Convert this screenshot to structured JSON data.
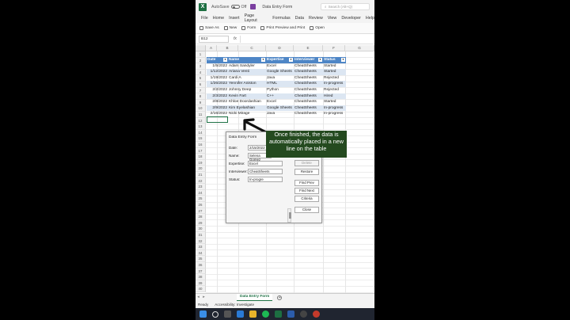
{
  "app": {
    "autosave_label": "AutoSave",
    "autosave_state": "Off",
    "doc_title": "Data Entry Form",
    "search_placeholder": "Search (Alt+Q)"
  },
  "menu": [
    "File",
    "Home",
    "Insert",
    "Page Layout",
    "Formulas",
    "Data",
    "Review",
    "View",
    "Developer",
    "Help"
  ],
  "toolbar": [
    "Save As",
    "New",
    "Form",
    "Print Preview and Print",
    "Open"
  ],
  "formula_bar": {
    "name_box": "B12",
    "fx": "fx"
  },
  "columns": [
    "A",
    "B",
    "C",
    "D",
    "E",
    "F",
    "G"
  ],
  "rows": [
    "1",
    "2",
    "3",
    "4",
    "5",
    "6",
    "7",
    "8",
    "9",
    "10",
    "11",
    "12",
    "13",
    "14",
    "15",
    "16",
    "17",
    "18",
    "19",
    "20",
    "21",
    "22",
    "23",
    "24",
    "25",
    "26",
    "27",
    "28",
    "29",
    "30",
    "31",
    "32",
    "33",
    "34",
    "35",
    "36",
    "37",
    "38",
    "39",
    "40"
  ],
  "table": {
    "headers": [
      "Date",
      "Name",
      "Expertise",
      "Interviewer",
      "Status"
    ],
    "rows": [
      [
        "1/5/2022",
        "Adam Sandyler",
        "Excel",
        "CheatSheets",
        "Started"
      ],
      [
        "1/12/2022",
        "Ariana Venti",
        "Google Sheets",
        "CheatSheets",
        "Started"
      ],
      [
        "1/19/2022",
        "Cardi A",
        "Java",
        "CheatSheets",
        "Rejected"
      ],
      [
        "1/26/2022",
        "Yennifer Aniston",
        "HTML",
        "CheatSheets",
        "In-progress"
      ],
      [
        "2/2/2022",
        "Johnny Deep",
        "Python",
        "CheatSheets",
        "Rejected"
      ],
      [
        "2/3/2022",
        "Kevin Fart",
        "C++",
        "CheatSheets",
        "Hired"
      ],
      [
        "2/8/2022",
        "Khloe Doordashian",
        "Excel",
        "CheatSheets",
        "Started"
      ],
      [
        "2/9/2022",
        "Kim Eyelashian",
        "Google Sheets",
        "CheatSheets",
        "In-progress"
      ],
      [
        "2/16/2022",
        "Nicki Mirage",
        "Java",
        "CheatSheets",
        "In-progress"
      ]
    ]
  },
  "dialog": {
    "title": "Data Entry Form",
    "fields": [
      {
        "label": "Date:",
        "value": "2/15/2022"
      },
      {
        "label": "Name:",
        "value": "Selena Gomez"
      },
      {
        "label": "Expertise:",
        "value": "Excel"
      },
      {
        "label": "Interviewer:",
        "value": "CheatSheets"
      },
      {
        "label": "Status:",
        "value": "In-progre"
      }
    ],
    "buttons": [
      "Delete",
      "Restore",
      "Find Prev",
      "Find Next",
      "Criteria",
      "Close"
    ]
  },
  "annotation": "Once finished, the data is automatically placed in a new line on the table",
  "sheet_tab": "Data Entry Form",
  "status": {
    "ready": "Ready",
    "accessibility": "Accessibility: Investigate"
  },
  "colors": {
    "excel_green": "#1e7145",
    "table_header": "#4e86c6",
    "table_band": "#dce6f2",
    "callout_bg": "#244a1f"
  }
}
